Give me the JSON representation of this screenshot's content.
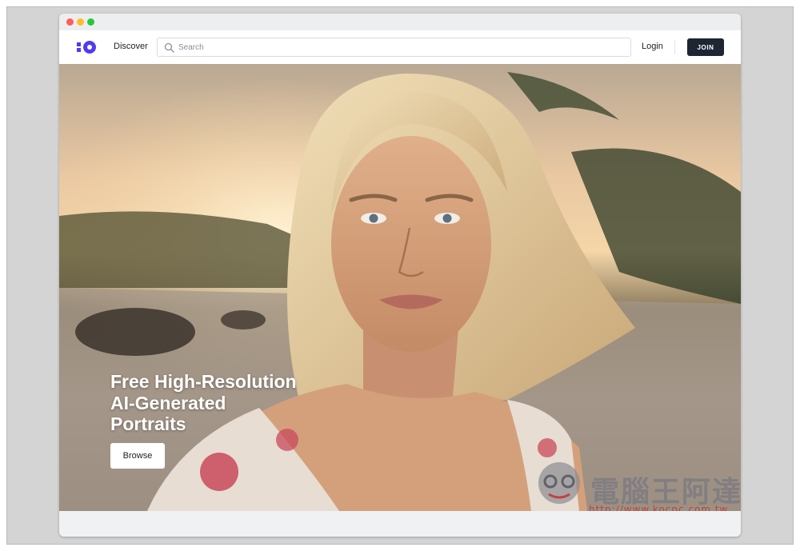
{
  "nav": {
    "discover_label": "Discover",
    "search_placeholder": "Search",
    "login_label": "Login",
    "join_label": "JOIN"
  },
  "hero": {
    "headline_lines": [
      "Free High-Resolution",
      "AI-Generated",
      "Portraits"
    ],
    "browse_label": "Browse"
  },
  "watermark": {
    "text": "電腦王阿達",
    "url": "http://www.kocpc.com.tw"
  },
  "colors": {
    "brand": "#4f3cf0",
    "join_button": "#1e2533"
  },
  "icons": {
    "logo": "brand-logo",
    "search": "search-icon"
  }
}
